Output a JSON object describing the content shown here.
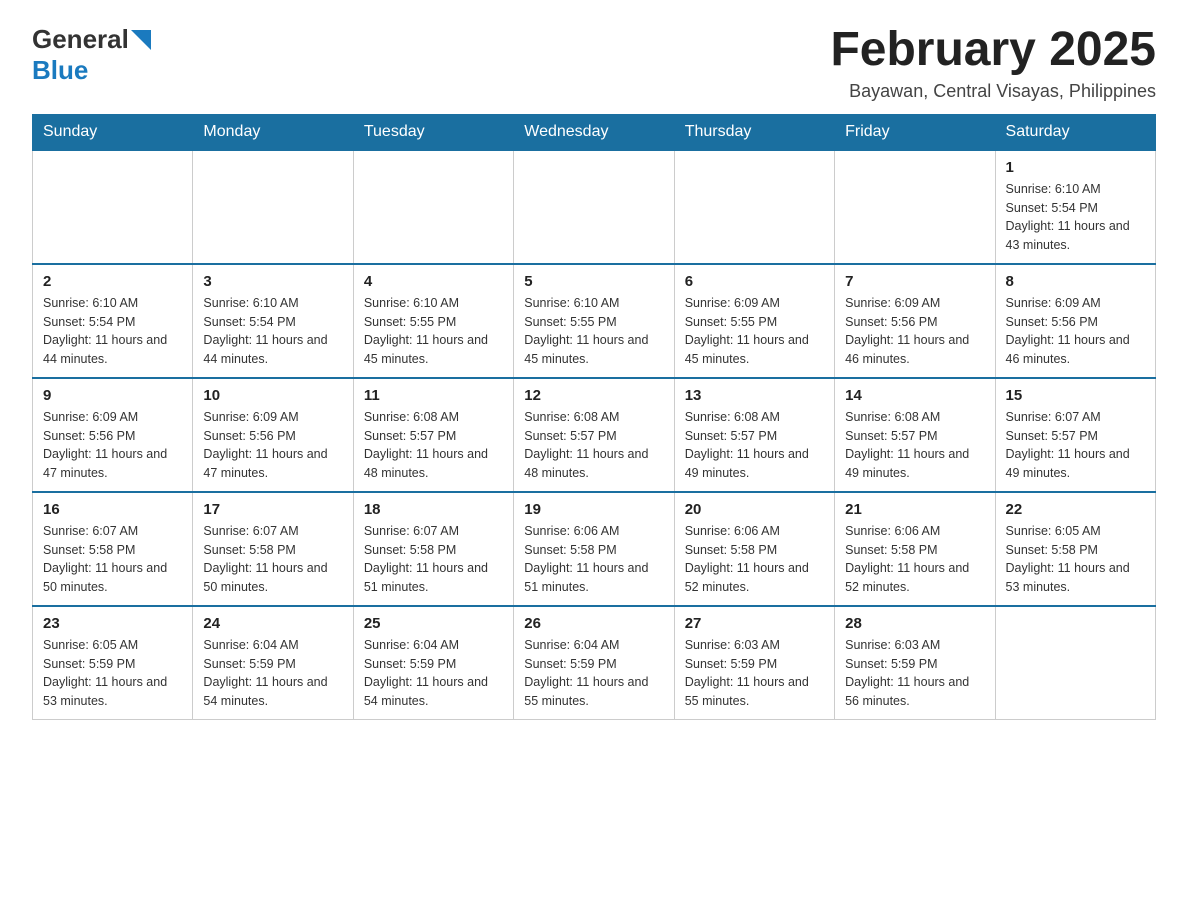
{
  "header": {
    "logo_general": "General",
    "logo_blue": "Blue",
    "title": "February 2025",
    "subtitle": "Bayawan, Central Visayas, Philippines"
  },
  "days_of_week": [
    "Sunday",
    "Monday",
    "Tuesday",
    "Wednesday",
    "Thursday",
    "Friday",
    "Saturday"
  ],
  "weeks": [
    {
      "days": [
        {
          "number": "",
          "info": ""
        },
        {
          "number": "",
          "info": ""
        },
        {
          "number": "",
          "info": ""
        },
        {
          "number": "",
          "info": ""
        },
        {
          "number": "",
          "info": ""
        },
        {
          "number": "",
          "info": ""
        },
        {
          "number": "1",
          "info": "Sunrise: 6:10 AM\nSunset: 5:54 PM\nDaylight: 11 hours and 43 minutes."
        }
      ]
    },
    {
      "days": [
        {
          "number": "2",
          "info": "Sunrise: 6:10 AM\nSunset: 5:54 PM\nDaylight: 11 hours and 44 minutes."
        },
        {
          "number": "3",
          "info": "Sunrise: 6:10 AM\nSunset: 5:54 PM\nDaylight: 11 hours and 44 minutes."
        },
        {
          "number": "4",
          "info": "Sunrise: 6:10 AM\nSunset: 5:55 PM\nDaylight: 11 hours and 45 minutes."
        },
        {
          "number": "5",
          "info": "Sunrise: 6:10 AM\nSunset: 5:55 PM\nDaylight: 11 hours and 45 minutes."
        },
        {
          "number": "6",
          "info": "Sunrise: 6:09 AM\nSunset: 5:55 PM\nDaylight: 11 hours and 45 minutes."
        },
        {
          "number": "7",
          "info": "Sunrise: 6:09 AM\nSunset: 5:56 PM\nDaylight: 11 hours and 46 minutes."
        },
        {
          "number": "8",
          "info": "Sunrise: 6:09 AM\nSunset: 5:56 PM\nDaylight: 11 hours and 46 minutes."
        }
      ]
    },
    {
      "days": [
        {
          "number": "9",
          "info": "Sunrise: 6:09 AM\nSunset: 5:56 PM\nDaylight: 11 hours and 47 minutes."
        },
        {
          "number": "10",
          "info": "Sunrise: 6:09 AM\nSunset: 5:56 PM\nDaylight: 11 hours and 47 minutes."
        },
        {
          "number": "11",
          "info": "Sunrise: 6:08 AM\nSunset: 5:57 PM\nDaylight: 11 hours and 48 minutes."
        },
        {
          "number": "12",
          "info": "Sunrise: 6:08 AM\nSunset: 5:57 PM\nDaylight: 11 hours and 48 minutes."
        },
        {
          "number": "13",
          "info": "Sunrise: 6:08 AM\nSunset: 5:57 PM\nDaylight: 11 hours and 49 minutes."
        },
        {
          "number": "14",
          "info": "Sunrise: 6:08 AM\nSunset: 5:57 PM\nDaylight: 11 hours and 49 minutes."
        },
        {
          "number": "15",
          "info": "Sunrise: 6:07 AM\nSunset: 5:57 PM\nDaylight: 11 hours and 49 minutes."
        }
      ]
    },
    {
      "days": [
        {
          "number": "16",
          "info": "Sunrise: 6:07 AM\nSunset: 5:58 PM\nDaylight: 11 hours and 50 minutes."
        },
        {
          "number": "17",
          "info": "Sunrise: 6:07 AM\nSunset: 5:58 PM\nDaylight: 11 hours and 50 minutes."
        },
        {
          "number": "18",
          "info": "Sunrise: 6:07 AM\nSunset: 5:58 PM\nDaylight: 11 hours and 51 minutes."
        },
        {
          "number": "19",
          "info": "Sunrise: 6:06 AM\nSunset: 5:58 PM\nDaylight: 11 hours and 51 minutes."
        },
        {
          "number": "20",
          "info": "Sunrise: 6:06 AM\nSunset: 5:58 PM\nDaylight: 11 hours and 52 minutes."
        },
        {
          "number": "21",
          "info": "Sunrise: 6:06 AM\nSunset: 5:58 PM\nDaylight: 11 hours and 52 minutes."
        },
        {
          "number": "22",
          "info": "Sunrise: 6:05 AM\nSunset: 5:58 PM\nDaylight: 11 hours and 53 minutes."
        }
      ]
    },
    {
      "days": [
        {
          "number": "23",
          "info": "Sunrise: 6:05 AM\nSunset: 5:59 PM\nDaylight: 11 hours and 53 minutes."
        },
        {
          "number": "24",
          "info": "Sunrise: 6:04 AM\nSunset: 5:59 PM\nDaylight: 11 hours and 54 minutes."
        },
        {
          "number": "25",
          "info": "Sunrise: 6:04 AM\nSunset: 5:59 PM\nDaylight: 11 hours and 54 minutes."
        },
        {
          "number": "26",
          "info": "Sunrise: 6:04 AM\nSunset: 5:59 PM\nDaylight: 11 hours and 55 minutes."
        },
        {
          "number": "27",
          "info": "Sunrise: 6:03 AM\nSunset: 5:59 PM\nDaylight: 11 hours and 55 minutes."
        },
        {
          "number": "28",
          "info": "Sunrise: 6:03 AM\nSunset: 5:59 PM\nDaylight: 11 hours and 56 minutes."
        },
        {
          "number": "",
          "info": ""
        }
      ]
    }
  ]
}
